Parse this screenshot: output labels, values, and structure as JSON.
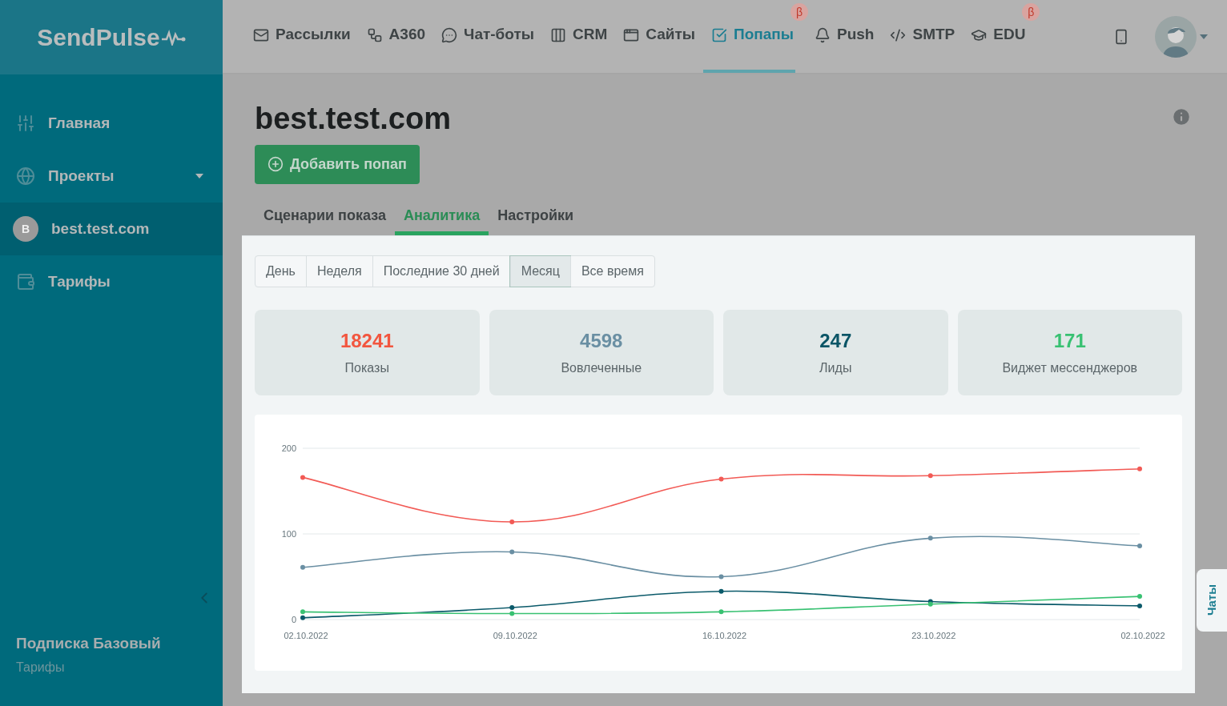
{
  "logo": "SendPulse",
  "nav": [
    {
      "label": "Рассылки",
      "selected": false
    },
    {
      "label": "A360",
      "selected": false
    },
    {
      "label": "Чат-боты",
      "selected": false
    },
    {
      "label": "CRM",
      "selected": false
    },
    {
      "label": "Сайты",
      "selected": false
    },
    {
      "label": "Попапы",
      "selected": true,
      "badge": "β"
    },
    {
      "label": "Push",
      "selected": false
    },
    {
      "label": "SMTP",
      "selected": false
    },
    {
      "label": "EDU",
      "selected": false,
      "badge": "β"
    }
  ],
  "sidebar": {
    "items": [
      {
        "label": "Главная",
        "kind": "link",
        "selected": false
      },
      {
        "label": "Проекты",
        "kind": "dropdown",
        "selected": false
      },
      {
        "label": "best.test.com",
        "kind": "project",
        "avatar": "B",
        "selected": true
      },
      {
        "label": "Тарифы",
        "kind": "link",
        "selected": false
      }
    ],
    "plan": "Подписка Базовый",
    "plan_link": "Тарифы"
  },
  "page": {
    "title": "best.test.com",
    "add_button": "Добавить попап",
    "tabs": [
      {
        "label": "Сценарии показа",
        "selected": false
      },
      {
        "label": "Аналитика",
        "selected": true
      },
      {
        "label": "Настройки",
        "selected": false
      }
    ],
    "periods": [
      {
        "label": "День",
        "selected": false
      },
      {
        "label": "Неделя",
        "selected": false
      },
      {
        "label": "Последние 30 дней",
        "selected": false
      },
      {
        "label": "Месяц",
        "selected": true
      },
      {
        "label": "Все время",
        "selected": false
      }
    ],
    "stats": [
      {
        "value": "18241",
        "label": "Показы",
        "color": "#f2563f"
      },
      {
        "value": "4598",
        "label": "Вовлеченные",
        "color": "#6a8fa3"
      },
      {
        "value": "247",
        "label": "Лиды",
        "color": "#0b5566"
      },
      {
        "value": "171",
        "label": "Виджет мессенджеров",
        "color": "#38c172"
      }
    ],
    "chart_data": {
      "type": "line",
      "categories": [
        "02.10.2022",
        "09.10.2022",
        "16.10.2022",
        "23.10.2022",
        "02.10.2022"
      ],
      "ylim": [
        0,
        200
      ],
      "yticks": [
        0,
        100,
        200
      ],
      "series": [
        {
          "color": "#f25a55",
          "marker": "circle",
          "values": [
            166,
            114,
            164,
            168,
            176
          ]
        },
        {
          "color": "#6a8fa3",
          "marker": "circle",
          "values": [
            61,
            79,
            50,
            95,
            86
          ]
        },
        {
          "color": "#0b5a6a",
          "marker": "circle",
          "values": [
            2,
            14,
            33,
            21,
            16
          ]
        },
        {
          "color": "#38c172",
          "marker": "circle",
          "values": [
            9,
            7,
            9,
            18,
            27
          ]
        }
      ]
    },
    "chat_tab": "Чаты"
  }
}
